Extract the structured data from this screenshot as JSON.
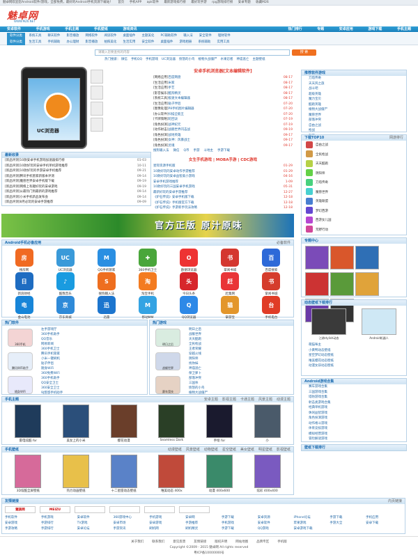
{
  "topbar": {
    "welcome": "魅卓网欢迎您Android软件/游戏，全部免费，最好的Android手机资源下载站！",
    "links": [
      "首页",
      "手机APP",
      "apk软件",
      "最新游戏排行榜",
      "最好玩手游",
      "rpg游戏排行榜",
      "安卓专题",
      "收藏M26"
    ]
  },
  "logo": {
    "name": "魅卓网",
    "domain": "WWW.MZ6.NET"
  },
  "nav": {
    "items": [
      "安卓软件",
      "手机游戏",
      "手机主题",
      "手机壁纸",
      "游戏资讯"
    ],
    "right": [
      "热门排行",
      "专题",
      "安卓应用",
      "游戏下载",
      "手机主题"
    ]
  },
  "subnav": {
    "row1_tag": "软件分类",
    "row1": [
      "系统工具",
      "聊天软件",
      "影音播放",
      "网络软件",
      "阅读软件",
      "桌面插件",
      "主题美化",
      "PC辅助软件",
      "输入法",
      "安全软件",
      "理财软件"
    ],
    "row2_tag": "软件分类",
    "row2": [
      "生活工具",
      "手机辅助",
      "办公理财",
      "影音播放",
      "拍照美化",
      "生活实用",
      "安全软件",
      "桌面插件",
      "游戏相册",
      "系统辅助",
      "实用工具"
    ]
  },
  "search": {
    "placeholder": "请输入您要查找的内容",
    "button": "搜 索",
    "hot_label": "热门搜索：",
    "hot": [
      "微信",
      "手机QQ",
      "手机游戏",
      "UC浏览器",
      "愤怒的小鸟",
      "植物大战僵尸",
      "水果忍者",
      "神庙逃亡",
      "主题壁纸"
    ]
  },
  "hotnews": {
    "title": "安卓手机浏览器[文本编辑软件]",
    "items": [
      {
        "cat": "[网络应用]",
        "title": "百度网盘",
        "date": "08-17"
      },
      {
        "cat": "[生活应用]",
        "title": "米家",
        "date": "08-17"
      },
      {
        "cat": "[生活应用]",
        "title": "手艺",
        "date": "08-17"
      },
      {
        "cat": "[影音娱乐]",
        "title": "酷狗精灵",
        "date": "08-17"
      },
      {
        "cat": "[系统工具]",
        "title": "极速文本编辑器",
        "date": "08-17"
      },
      {
        "cat": "[生活应用]",
        "title": "贴子伴侣",
        "date": "07-20"
      },
      {
        "cat": "[图像处理]",
        "title": "P8手机图片编辑器",
        "date": "07-20"
      },
      {
        "cat": "[办公软件]",
        "title": "扫描全能王",
        "date": "07-20"
      },
      {
        "cat": "[卡牌策略]",
        "title": "轮回诀",
        "date": "07-19"
      },
      {
        "cat": "[角色扮演]",
        "title": "战神纪元",
        "date": "07-19"
      },
      {
        "cat": "[动作射击]",
        "title": "战舰世界闪击战",
        "date": "09-19"
      },
      {
        "cat": "[角色扮演]",
        "title": "战地英雄",
        "date": "09-17"
      },
      {
        "cat": "[角色扮演]",
        "title": "女神：风暴战士",
        "date": "09-17"
      },
      {
        "cat": "[角色扮演]",
        "title": "灵魂",
        "date": "09-17"
      }
    ],
    "tags": [
      "搜狗输入法",
      "微信",
      "Q币",
      "手游",
      "斗地主",
      "手游下载"
    ]
  },
  "newest": {
    "title": "最新收录",
    "items": [
      {
        "cat": "[新品评测]",
        "title": "10款安卓手机游戏加速器排行榜",
        "date": "01-03"
      },
      {
        "cat": "[新品评测]",
        "title": "10款好玩的安卓手机单机游戏推荐",
        "date": "10-11"
      },
      {
        "cat": "[新品评测]",
        "title": "10款好玩的手游安卓手机推荐",
        "date": "09-21"
      },
      {
        "cat": "[新品评测]",
        "title": "腾讯手机管家新版本评测",
        "date": "09-14"
      },
      {
        "cat": "[新品评测]",
        "title": "魔兽世界安卓手机版下载",
        "date": "09-19"
      },
      {
        "cat": "[新品评测]",
        "title": "网络上有趣好玩的安卓游戏",
        "date": "09-19"
      },
      {
        "cat": "[新品评测]",
        "title": "从最热门到最新的游戏推荐",
        "date": "09-14"
      },
      {
        "cat": "[新品评测]",
        "title": "小米手机新品发布会",
        "date": "09-14"
      },
      {
        "cat": "[新品评测]",
        "title": "8月必玩的安卓手游推荐",
        "date": "09-09"
      }
    ]
  },
  "midlist": {
    "title": "女生手机游戏 | MOBA手游 | CDC游戏",
    "items": [
      {
        "title": "星际资源手机版",
        "date": "01-29"
      },
      {
        "title": "10款好玩的安卓动作手游推荐",
        "date": "01-29"
      },
      {
        "title": "10款好玩的安卓益智类小游戏",
        "date": "04-16"
      },
      {
        "title": "安卓手机游戏推荐",
        "date": "1-09"
      },
      {
        "title": "10款好玩的三国安卓手机游戏",
        "date": "05-31"
      },
      {
        "title": "最新好玩的安卓手游推荐",
        "date": "12-27"
      },
      {
        "title": "《炉石传说》安卓手机版下载",
        "date": "12-18"
      },
      {
        "title": "《炉石传说》手机版官方下载",
        "date": "12-18"
      },
      {
        "title": "《炉石传说》手游新手玩法攻略",
        "date": "12-18"
      }
    ]
  },
  "banner": {
    "text": "官方正版 原汁原味"
  },
  "android": {
    "title": "Android手机必备应用",
    "more": "必备软件",
    "apps": [
      {
        "name": "搜房网",
        "color": "#f06a22",
        "glyph": "房"
      },
      {
        "name": "UC浏览器",
        "color": "#3a9ad9",
        "glyph": "UC"
      },
      {
        "name": "QQ手机管家",
        "color": "#2a8fe2",
        "glyph": "M"
      },
      {
        "name": "360手机卫士",
        "color": "#4aa63b",
        "glyph": "✚"
      },
      {
        "name": "欧朋浏览器",
        "color": "#e33",
        "glyph": "O"
      },
      {
        "name": "掌阅书城",
        "color": "#d4372f",
        "glyph": "书"
      },
      {
        "name": "百度搜索",
        "color": "#2d69d8",
        "glyph": "百"
      },
      {
        "name": "新浪财经",
        "color": "#1e6cc1",
        "glyph": "日"
      },
      {
        "name": "酷我音乐",
        "color": "#1a9be0",
        "glyph": "♪"
      },
      {
        "name": "搜狗输入法",
        "color": "#ee6e1f",
        "glyph": "S"
      },
      {
        "name": "淘宝手机",
        "color": "#f37b20",
        "glyph": "淘"
      },
      {
        "name": "今日头条",
        "color": "#d7262c",
        "glyph": "头"
      },
      {
        "name": "赶集网",
        "color": "#e93537",
        "glyph": "赶"
      },
      {
        "name": "掌阅书城",
        "color": "#d53c2c",
        "glyph": "书"
      },
      {
        "name": "金山电池",
        "color": "#1785d8",
        "glyph": "电"
      },
      {
        "name": "京东商城",
        "color": "#2e8ad8",
        "glyph": "京"
      },
      {
        "name": "迅雷",
        "color": "#1c75ce",
        "glyph": "迅"
      },
      {
        "name": "移动MM",
        "color": "#34a3e3",
        "glyph": "M"
      },
      {
        "name": "QQ浏览器",
        "color": "#2e89e7",
        "glyph": "Q"
      },
      {
        "name": "掌游宝",
        "color": "#e3962b",
        "glyph": "猫"
      },
      {
        "name": "手机电台",
        "color": "#e03c26",
        "glyph": "台"
      }
    ]
  },
  "soft": {
    "title": "热门软件",
    "items": [
      "左手游戏厅",
      "360手机助手",
      "QQ音乐",
      "网易新闻",
      "360手机卫士",
      "腾讯手机管家",
      "小米一键刷机",
      "贴子伴侣",
      "随身WiFi",
      "360免费WiFi",
      "360手机助手",
      "QQ安全卫士",
      "360安全卫士",
      "9J悠悠手机助手"
    ],
    "side": [
      "360手机",
      "腾讯WiFi助手",
      "随身WiFi"
    ]
  },
  "games": {
    "title": "热门游戏",
    "items": [
      "明日之后",
      "战舰世界",
      "天天酷跑",
      "全民枪战",
      "王者荣耀",
      "穿越火线",
      "阴阳师",
      "找你妹",
      "神庙逃亡",
      "保卫萝卜",
      "部落冲突",
      "三国杀",
      "愤怒的小鸟",
      "植物大战僵尸"
    ],
    "side": [
      "明日之后",
      "战舰世界",
      "赛车竞技"
    ]
  },
  "theme": {
    "title": "手机主题",
    "tabs": [
      "安卓主题",
      "影视主题",
      "卡通主题",
      "风景主题",
      "动漫主题"
    ],
    "items": [
      "雷电炫酷 for",
      "美女上的小米",
      "樱花动漫",
      "Seamless Dark",
      "手绘 for",
      "小"
    ]
  },
  "wallpaper": {
    "title": "手机壁纸",
    "tabs": [
      "动漫壁纸",
      "风景壁纸",
      "动物壁纸",
      "星空壁纸",
      "美女壁纸",
      "明星壁纸",
      "影视壁纸"
    ],
    "items": [
      "3D炫酷全屏壁纸",
      "热力动画壁纸",
      "十二星座动态壁纸",
      "唯美动态 400x",
      "动漫 400x600",
      "炫彩 400x400"
    ]
  },
  "right": {
    "recommend_title": "推荐软件游戏",
    "recommend_tabs": [
      "游戏",
      "软件"
    ],
    "recommend": [
      "刀塔传奇",
      "天天风之旅",
      "战斗吧",
      "超级英雄",
      "魔力宝贝",
      "酷跑英雄",
      "植物大战僵尸",
      "魔兽世界",
      "部落冲突",
      "自由之战",
      "枪战",
      "刺客"
    ],
    "top_title": "下载TOP10",
    "top_tabs": [
      "网游排行",
      "单机排行"
    ],
    "top": [
      "自由之战",
      "全民枪战",
      "天天酷跑",
      "阴阳师",
      "刀塔传奇",
      "魔兽世界",
      "英雄联盟",
      "梦幻西游",
      "西游女儿国",
      "荒野行动"
    ],
    "topic_title": "专题中心",
    "live_title": "动态壁纸下载排行",
    "live_imgs": [
      "江湖stylish动态",
      "Android机器人"
    ],
    "live": [
      "萌猫咪主",
      "小黄鸭动态壁纸",
      "星空梦幻动态壁纸",
      "唯美樱花动态壁纸",
      "动漫女孩动态壁纸"
    ],
    "game_news_title": "Android游戏合集",
    "game_news": [
      "赛车游戏合集",
      "三国游戏合集",
      "塔防游戏合集",
      "射击类游戏合集",
      "经典单机游戏",
      "休闲益智游戏",
      "角色扮演游戏",
      "动作格斗游戏",
      "体育竞技游戏",
      "模拟经营游戏",
      "冒险解谜游戏"
    ],
    "wp_rank_title": "壁纸下载排行"
  },
  "links": {
    "title": "友情链接",
    "right": "内页链接",
    "logos": [
      "魅族网",
      "MEIZU",
      "",
      "",
      "",
      ""
    ],
    "items": [
      "手机软件",
      "手机游戏",
      "安卓软件",
      "360游戏中心",
      "手机游戏",
      "安卓网",
      "手游下载",
      "安卓资源",
      "iPhone论坛",
      "手游下载",
      "手机应用",
      "安卓游戏",
      "手游排行",
      "TV游戏",
      "安卓市场",
      "安卓游戏",
      "手游推荐",
      "手机游戏",
      "安卓软件",
      "苹果游戏",
      "手游大全",
      "安卓下载",
      "手游攻略",
      "手游排行",
      "安卓论坛",
      "手游资讯",
      "刷机网",
      "刷机精灵",
      "手游下载",
      "QQ游戏",
      "安卓游戏下载"
    ]
  },
  "footer": {
    "links": [
      "关于我们",
      "联系我们",
      "意见反馈",
      "友情链接",
      "版权声明",
      "网站地图",
      "品牌专区",
      "手机版"
    ],
    "copy": "Copyright ©2009 - 2015 魅卓网 All rights reserved",
    "icp": "粤ICP备10000000号"
  }
}
